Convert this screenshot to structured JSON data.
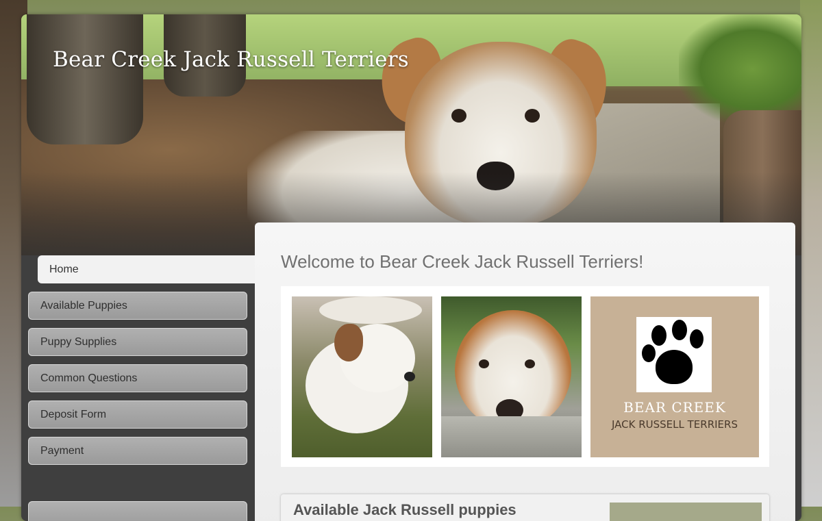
{
  "header": {
    "site_title": "Bear Creek Jack Russell Terriers"
  },
  "nav": {
    "items": [
      {
        "label": "Home",
        "active": true
      },
      {
        "label": "Available Puppies",
        "active": false
      },
      {
        "label": "Puppy Supplies",
        "active": false
      },
      {
        "label": "Common Questions",
        "active": false
      },
      {
        "label": "Deposit Form",
        "active": false
      },
      {
        "label": "Payment",
        "active": false
      }
    ]
  },
  "main": {
    "welcome_heading": "Welcome to Bear Creek Jack Russell Terriers!",
    "logo_line1": "BEAR CREEK",
    "logo_line2": "JACK RUSSELL TERRIERS",
    "section_heading": "Available Jack Russell puppies"
  },
  "colors": {
    "sidebar_bg": "#3f3f3f",
    "nav_button": "#a3a3a3",
    "panel_bg": "#efefef",
    "logo_tan": "#c7b196"
  }
}
